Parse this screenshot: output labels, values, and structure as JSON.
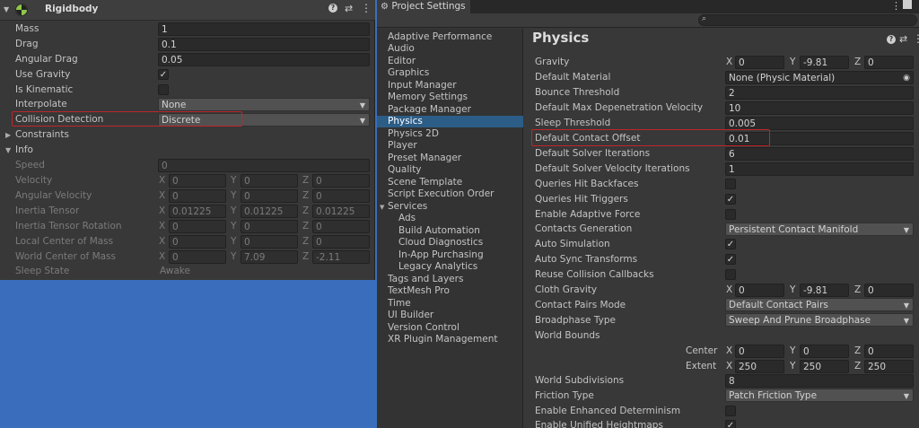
{
  "inspector": {
    "component_title": "Rigidbody",
    "fields": [
      {
        "label": "Mass",
        "value": "1"
      },
      {
        "label": "Drag",
        "value": "0.1"
      },
      {
        "label": "Angular Drag",
        "value": "0.05"
      },
      {
        "label": "Use Gravity"
      },
      {
        "label": "Is Kinematic"
      },
      {
        "label": "Interpolate",
        "value": "None"
      },
      {
        "label": "Collision Detection",
        "value": "Discrete"
      }
    ],
    "constraints_label": "Constraints",
    "info_label": "Info",
    "info_fields": [
      {
        "label": "Speed",
        "value": "0"
      },
      {
        "label": "Velocity",
        "x": "0",
        "y": "0",
        "z": "0"
      },
      {
        "label": "Angular Velocity",
        "x": "0",
        "y": "0",
        "z": "0"
      },
      {
        "label": "Inertia Tensor",
        "x": "0.01225",
        "y": "0.01225",
        "z": "0.01225"
      },
      {
        "label": "Inertia Tensor Rotation",
        "x": "0",
        "y": "0",
        "z": "0"
      },
      {
        "label": "Local Center of Mass",
        "x": "0",
        "y": "0",
        "z": "0"
      },
      {
        "label": "World Center of Mass",
        "x": "0",
        "y": "7.09",
        "z": "-2.11"
      },
      {
        "label": "Sleep State",
        "value": "Awake"
      }
    ],
    "use_gravity": true,
    "is_kinematic": false
  },
  "axis": {
    "x": "X",
    "y": "Y",
    "z": "Z"
  },
  "project_settings": {
    "tab_title": "Project Settings",
    "search_value": "",
    "sidebar": [
      "Adaptive Performance",
      "Audio",
      "Editor",
      "Graphics",
      "Input Manager",
      "Memory Settings",
      "Package Manager",
      "Physics",
      "Physics 2D",
      "Player",
      "Preset Manager",
      "Quality",
      "Scene Template",
      "Script Execution Order",
      "Services",
      "Ads",
      "Build Automation",
      "Cloud Diagnostics",
      "In-App Purchasing",
      "Legacy Analytics",
      "Tags and Layers",
      "TextMesh Pro",
      "Time",
      "UI Builder",
      "Version Control",
      "XR Plugin Management"
    ],
    "selected_item": "Physics",
    "page_title": "Physics",
    "gravity": {
      "label": "Gravity",
      "x": "0",
      "y": "-9.81",
      "z": "0"
    },
    "rows": [
      {
        "label": "Default Material",
        "value": "None (Physic Material)"
      },
      {
        "label": "Bounce Threshold",
        "value": "2"
      },
      {
        "label": "Default Max Depenetration Velocity",
        "value": "10"
      },
      {
        "label": "Sleep Threshold",
        "value": "0.005"
      },
      {
        "label": "Default Contact Offset",
        "value": "0.01"
      },
      {
        "label": "Default Solver Iterations",
        "value": "6"
      },
      {
        "label": "Default Solver Velocity Iterations",
        "value": "1"
      },
      {
        "label": "Queries Hit Backfaces",
        "checked": false
      },
      {
        "label": "Queries Hit Triggers",
        "checked": true
      },
      {
        "label": "Enable Adaptive Force",
        "checked": false
      },
      {
        "label": "Contacts Generation",
        "value": "Persistent Contact Manifold"
      },
      {
        "label": "Auto Simulation",
        "checked": true
      },
      {
        "label": "Auto Sync Transforms",
        "checked": true
      },
      {
        "label": "Reuse Collision Callbacks",
        "checked": false
      }
    ],
    "cloth_gravity": {
      "label": "Cloth Gravity",
      "x": "0",
      "y": "-9.81",
      "z": "0"
    },
    "contact_pairs_mode": {
      "label": "Contact Pairs Mode",
      "value": "Default Contact Pairs"
    },
    "broadphase_type": {
      "label": "Broadphase Type",
      "value": "Sweep And Prune Broadphase"
    },
    "world_bounds": {
      "label": "World Bounds",
      "center_label": "Center",
      "center": {
        "x": "0",
        "y": "0",
        "z": "0"
      },
      "extent_label": "Extent",
      "extent": {
        "x": "250",
        "y": "250",
        "z": "250"
      }
    },
    "world_subdivisions": {
      "label": "World Subdivisions",
      "value": "8"
    },
    "friction_type": {
      "label": "Friction Type",
      "value": "Patch Friction Type"
    },
    "enhanced_determinism": {
      "label": "Enable Enhanced Determinism",
      "checked": false
    },
    "unified_heightmaps": {
      "label": "Enable Unified Heightmaps",
      "checked": true
    }
  }
}
